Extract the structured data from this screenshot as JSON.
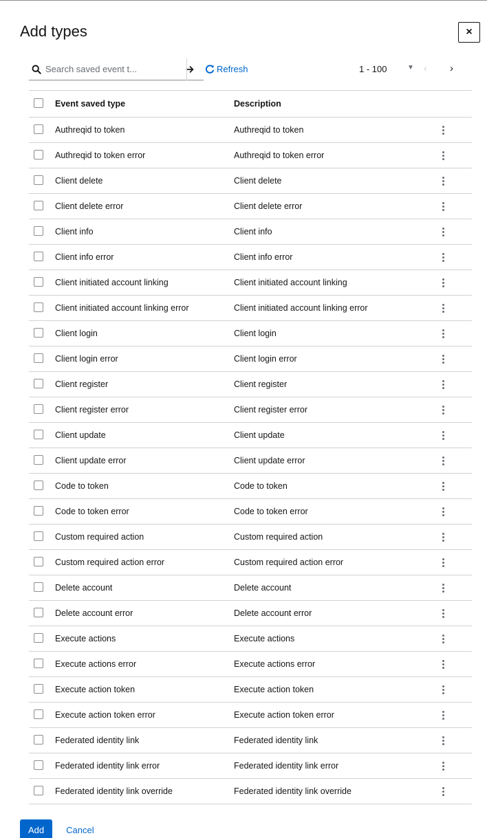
{
  "modal": {
    "title": "Add types",
    "close_label": "×"
  },
  "toolbar": {
    "search_placeholder": "Search saved event t...",
    "refresh_label": "Refresh",
    "pagination_range": "1 - 100"
  },
  "table": {
    "headers": [
      "Event saved type",
      "Description"
    ],
    "rows": [
      {
        "type": "Authreqid to token",
        "description": "Authreqid to token"
      },
      {
        "type": "Authreqid to token error",
        "description": "Authreqid to token error"
      },
      {
        "type": "Client delete",
        "description": "Client delete"
      },
      {
        "type": "Client delete error",
        "description": "Client delete error"
      },
      {
        "type": "Client info",
        "description": "Client info"
      },
      {
        "type": "Client info error",
        "description": "Client info error"
      },
      {
        "type": "Client initiated account linking",
        "description": "Client initiated account linking"
      },
      {
        "type": "Client initiated account linking error",
        "description": "Client initiated account linking error"
      },
      {
        "type": "Client login",
        "description": "Client login"
      },
      {
        "type": "Client login error",
        "description": "Client login error"
      },
      {
        "type": "Client register",
        "description": "Client register"
      },
      {
        "type": "Client register error",
        "description": "Client register error"
      },
      {
        "type": "Client update",
        "description": "Client update"
      },
      {
        "type": "Client update error",
        "description": "Client update error"
      },
      {
        "type": "Code to token",
        "description": "Code to token"
      },
      {
        "type": "Code to token error",
        "description": "Code to token error"
      },
      {
        "type": "Custom required action",
        "description": "Custom required action"
      },
      {
        "type": "Custom required action error",
        "description": "Custom required action error"
      },
      {
        "type": "Delete account",
        "description": "Delete account"
      },
      {
        "type": "Delete account error",
        "description": "Delete account error"
      },
      {
        "type": "Execute actions",
        "description": "Execute actions"
      },
      {
        "type": "Execute actions error",
        "description": "Execute actions error"
      },
      {
        "type": "Execute action token",
        "description": "Execute action token"
      },
      {
        "type": "Execute action token error",
        "description": "Execute action token error"
      },
      {
        "type": "Federated identity link",
        "description": "Federated identity link"
      },
      {
        "type": "Federated identity link error",
        "description": "Federated identity link error"
      },
      {
        "type": "Federated identity link override",
        "description": "Federated identity link override"
      }
    ]
  },
  "footer": {
    "add_label": "Add",
    "cancel_label": "Cancel"
  },
  "colors": {
    "primary": "#0066cc",
    "border": "#d2d2d2"
  }
}
